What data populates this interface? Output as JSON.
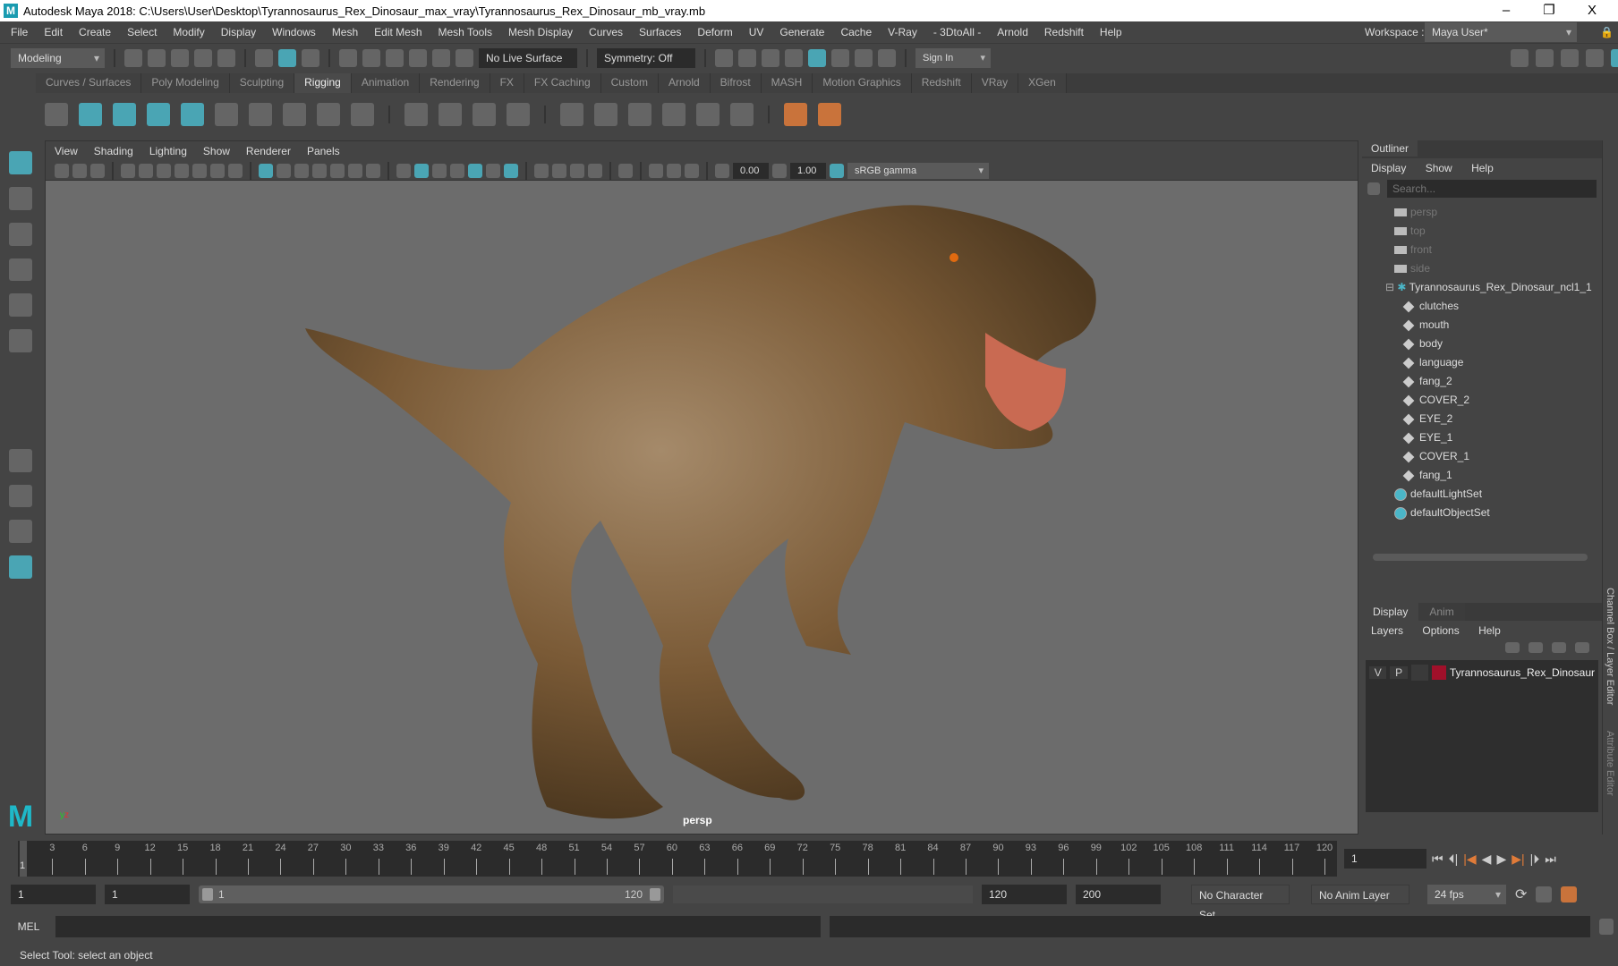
{
  "window": {
    "title": "Autodesk Maya 2018: C:\\Users\\User\\Desktop\\Tyrannosaurus_Rex_Dinosaur_max_vray\\Tyrannosaurus_Rex_Dinosaur_mb_vray.mb",
    "logo": "M",
    "minimize": "–",
    "maximize": "❐",
    "close": "X"
  },
  "menu": [
    "File",
    "Edit",
    "Create",
    "Select",
    "Modify",
    "Display",
    "Windows",
    "Mesh",
    "Edit Mesh",
    "Mesh Tools",
    "Mesh Display",
    "Curves",
    "Surfaces",
    "Deform",
    "UV",
    "Generate",
    "Cache",
    "V-Ray",
    "- 3DtoAll -",
    "Arnold",
    "Redshift",
    "Help"
  ],
  "workspace": {
    "label": "Workspace :",
    "value": "Maya User*"
  },
  "statusline": {
    "mode": "Modeling",
    "live_surface": "No Live Surface",
    "symmetry": "Symmetry: Off",
    "sign_in": "Sign In"
  },
  "shelf_tabs": [
    "Curves / Surfaces",
    "Poly Modeling",
    "Sculpting",
    "Rigging",
    "Animation",
    "Rendering",
    "FX",
    "FX Caching",
    "Custom",
    "Arnold",
    "Bifrost",
    "MASH",
    "Motion Graphics",
    "Redshift",
    "VRay",
    "XGen"
  ],
  "active_shelf": "Rigging",
  "viewport": {
    "menu": [
      "View",
      "Shading",
      "Lighting",
      "Show",
      "Renderer",
      "Panels"
    ],
    "exposure": "0.00",
    "gamma": "1.00",
    "color_space": "sRGB gamma",
    "camera": "persp"
  },
  "outliner": {
    "title": "Outliner",
    "menu": [
      "Display",
      "Show",
      "Help"
    ],
    "search_placeholder": "Search...",
    "cameras": [
      "persp",
      "top",
      "front",
      "side"
    ],
    "group": "Tyrannosaurus_Rex_Dinosaur_ncl1_1",
    "children": [
      "clutches",
      "mouth",
      "body",
      "language",
      "fang_2",
      "COVER_2",
      "EYE_2",
      "EYE_1",
      "COVER_1",
      "fang_1"
    ],
    "sets": [
      "defaultLightSet",
      "defaultObjectSet"
    ]
  },
  "layer_editor": {
    "tabs": [
      "Display",
      "Anim"
    ],
    "menu": [
      "Layers",
      "Options",
      "Help"
    ],
    "layer": {
      "v": "V",
      "p": "P",
      "name": "Tyrannosaurus_Rex_Dinosaur",
      "color": "#a0102a"
    }
  },
  "side_tabs": [
    "Channel Box / Layer Editor",
    "Attribute Editor"
  ],
  "timeline": {
    "start": 1,
    "end": 120,
    "step": 3,
    "current": "1",
    "current_label": "1"
  },
  "range": {
    "start": "1",
    "anim_start": "1",
    "slider_start": "1",
    "slider_end": "120",
    "end": "120",
    "anim_end": "200",
    "character_set": "No Character Set",
    "anim_layer": "No Anim Layer",
    "fps": "24 fps"
  },
  "mel": {
    "label": "MEL"
  },
  "status": "Select Tool: select an object",
  "colors": {
    "accent": "#4bb6c8",
    "viewport_bg": "#6c6c6c"
  }
}
